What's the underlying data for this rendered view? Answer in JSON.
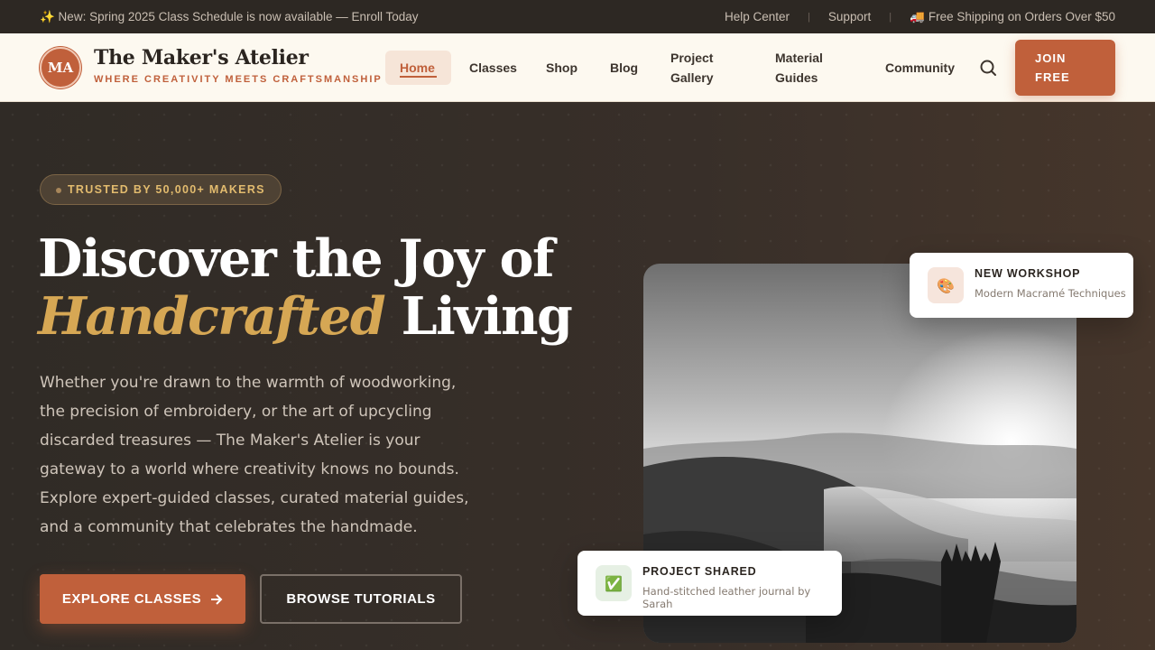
{
  "announcement": {
    "text": "✨ New: Spring 2025 Class Schedule is now available — Enroll Today",
    "links": [
      "Help Center",
      "Support"
    ],
    "shipping_icon": "🚚",
    "shipping_text": "Free Shipping on Orders Over $50"
  },
  "brand": {
    "initials": "MA",
    "name": "The Maker's Atelier",
    "tagline": "WHERE CREATIVITY MEETS CRAFTSMANSHIP"
  },
  "nav": {
    "items": [
      "Home",
      "Classes",
      "Shop",
      "Blog",
      "Project Gallery",
      "Material Guides",
      "Community"
    ],
    "active": "Home",
    "search_icon": "search-icon",
    "cta": "JOIN FREE"
  },
  "hero": {
    "badge": "TRUSTED BY 50,000+ MAKERS",
    "headline_line1": "Discover the Joy of",
    "headline_accent": "Handcrafted",
    "headline_rest": "Living",
    "lead": "Whether you're drawn to the warmth of woodworking, the precision of embroidery, or the art of upcycling discarded treasures — The Maker's Atelier is your gateway to a world where creativity knows no bounds. Explore expert-guided classes, curated material guides, and a community that celebrates the handmade.",
    "primary_cta": "EXPLORE CLASSES",
    "secondary_cta": "BROWSE TUTORIALS"
  },
  "cards": {
    "workshop": {
      "icon": "🎨",
      "title": "NEW WORKSHOP",
      "subtitle": "Modern Macramé Techniques"
    },
    "project": {
      "icon": "✅",
      "title": "PROJECT SHARED",
      "subtitle": "Hand-stitched leather journal by Sarah"
    }
  },
  "colors": {
    "accent": "#c0603b",
    "gold": "#d6a754",
    "dark": "#2d2823",
    "cream": "#fdf9f0"
  }
}
